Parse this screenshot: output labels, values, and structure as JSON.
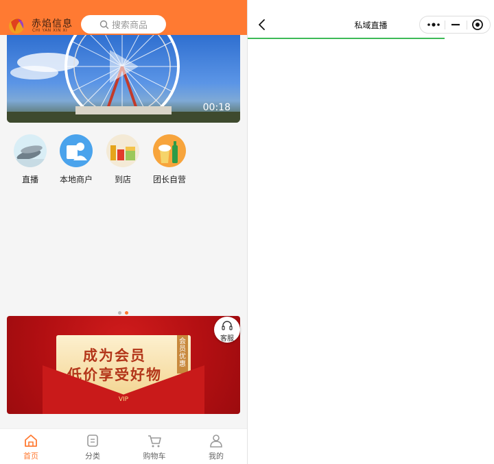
{
  "app": {
    "brand_name": "赤焰信息",
    "brand_sub": "CHI YAN XIN XI",
    "search_placeholder": "搜索商品"
  },
  "video": {
    "duration": "00:18"
  },
  "categories": [
    {
      "label": "直播",
      "icon": "fish-icon"
    },
    {
      "label": "本地商户",
      "icon": "merchant-icon"
    },
    {
      "label": "到店",
      "icon": "grocery-icon"
    },
    {
      "label": "团长自营",
      "icon": "drinks-icon"
    }
  ],
  "carousel": {
    "page_count": 2,
    "active_index": 1
  },
  "banner": {
    "line1": "成为会员",
    "line2": "低价享受好物",
    "tag": "会员优惠",
    "badge": "VIP",
    "service_label": "客服"
  },
  "tabbar": {
    "items": [
      {
        "label": "首页",
        "icon": "home-icon",
        "active": true
      },
      {
        "label": "分类",
        "icon": "category-icon",
        "active": false
      },
      {
        "label": "购物车",
        "icon": "cart-icon",
        "active": false
      },
      {
        "label": "我的",
        "icon": "profile-icon",
        "active": false
      }
    ]
  },
  "right_page": {
    "title": "私域直播",
    "load_progress": 0.8
  },
  "colors": {
    "accent": "#ff7a32",
    "banner_red": "#b20f12",
    "progress_green": "#3cba56"
  }
}
